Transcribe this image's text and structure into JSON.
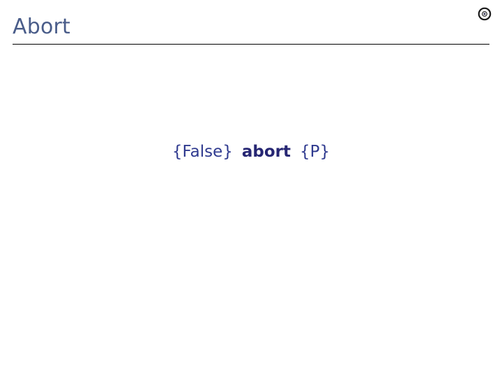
{
  "slide": {
    "title": "Abort",
    "background_color": "#ffffff",
    "title_color": "#4a5d8a",
    "rule_color": "#000000",
    "formula_color": "#2b2b7a"
  },
  "header": {
    "title": "Abort",
    "corner_icon": "disc-icon"
  },
  "formula": {
    "full_text": "{False} abort {P}",
    "open_brace": "{",
    "close_brace": "}",
    "precondition": "False",
    "statement": "abort",
    "postcondition": "P"
  }
}
